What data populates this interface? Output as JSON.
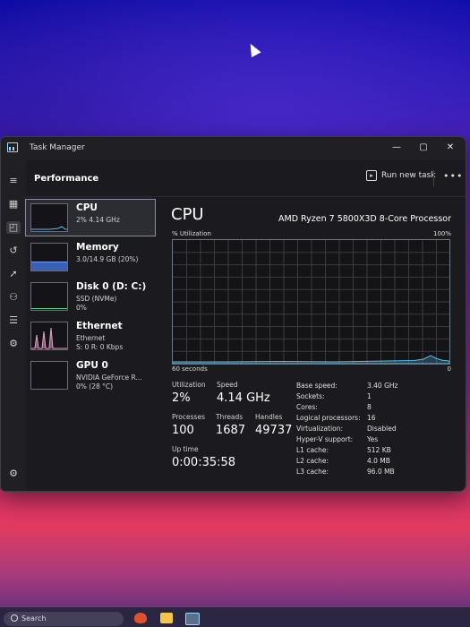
{
  "window": {
    "title": "Task Manager",
    "controls": {
      "minimize": "—",
      "maximize": "▢",
      "close": "✕"
    }
  },
  "nav_icons": [
    "hamburger-icon",
    "processes-icon",
    "performance-icon",
    "app-history-icon",
    "startup-apps-icon",
    "users-icon",
    "details-icon",
    "services-icon",
    "settings-icon"
  ],
  "header": {
    "title": "Performance",
    "run_new_task": "Run new task",
    "more": "•••"
  },
  "sidebar": [
    {
      "name": "CPU",
      "sub1": "2% 4.14 GHz",
      "sub2": "",
      "sub3": ""
    },
    {
      "name": "Memory",
      "sub1": "3.0/14.9 GB (20%)",
      "sub2": "",
      "sub3": ""
    },
    {
      "name": "Disk 0 (D: C:)",
      "sub1": "SSD (NVMe)",
      "sub2": "0%",
      "sub3": ""
    },
    {
      "name": "Ethernet",
      "sub1": "Ethernet",
      "sub2": "S: 0 R: 0 Kbps",
      "sub3": ""
    },
    {
      "name": "GPU 0",
      "sub1": "NVIDIA GeForce R...",
      "sub2": "0% (28 °C)",
      "sub3": ""
    }
  ],
  "cpu": {
    "title": "CPU",
    "processor": "AMD Ryzen 7 5800X3D 8-Core Processor",
    "util_label": "% Utilization",
    "util_max": "100%",
    "time_label": "60 seconds",
    "time_end": "0",
    "stats": {
      "utilization_label": "Utilization",
      "utilization": "2%",
      "speed_label": "Speed",
      "speed": "4.14 GHz",
      "processes_label": "Processes",
      "processes": "100",
      "threads_label": "Threads",
      "threads": "1687",
      "handles_label": "Handles",
      "handles": "49737",
      "uptime_label": "Up time",
      "uptime": "0:00:35:58"
    },
    "details": [
      {
        "label": "Base speed:",
        "value": "3.40 GHz"
      },
      {
        "label": "Sockets:",
        "value": "1"
      },
      {
        "label": "Cores:",
        "value": "8"
      },
      {
        "label": "Logical processors:",
        "value": "16"
      },
      {
        "label": "Virtualization:",
        "value": "Disabled"
      },
      {
        "label": "Hyper-V support:",
        "value": "Yes"
      },
      {
        "label": "L1 cache:",
        "value": "512 KB"
      },
      {
        "label": "L2 cache:",
        "value": "4.0 MB"
      },
      {
        "label": "L3 cache:",
        "value": "96.0 MB"
      }
    ]
  },
  "taskbar": {
    "search": "Search"
  },
  "colors": {
    "accent": "#4fc3f7",
    "memory": "#6aa0ff",
    "disk": "#5fd38a",
    "ethernet": "#e6a0c8"
  }
}
